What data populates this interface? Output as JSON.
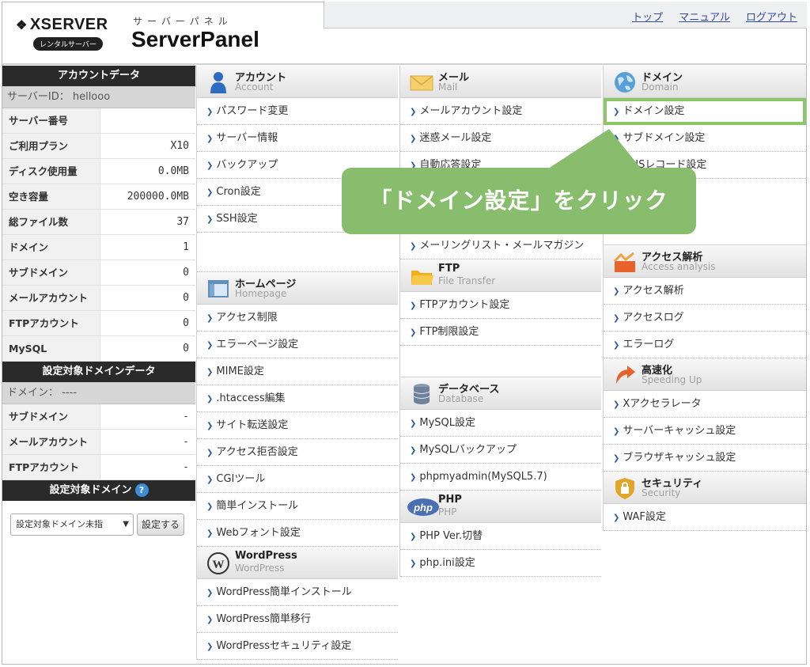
{
  "brand": {
    "xserver": "XSERVER",
    "rental": "レンタルサーバー",
    "kana": "サーバーパネル",
    "panel": "ServerPanel"
  },
  "top_links": [
    "トップ",
    "マニュアル",
    "ログアウト"
  ],
  "account_data": {
    "title": "アカウントデータ",
    "server_id": "サーバーID： hellooo",
    "rows": [
      {
        "label": "サーバー番号",
        "value": ""
      },
      {
        "label": "ご利用プラン",
        "value": "X10"
      },
      {
        "label": "ディスク使用量",
        "value": "0.0MB"
      },
      {
        "label": "空き容量",
        "value": "200000.0MB"
      },
      {
        "label": "総ファイル数",
        "value": "37"
      },
      {
        "label": "ドメイン",
        "value": "1"
      },
      {
        "label": "サブドメイン",
        "value": "0"
      },
      {
        "label": "メールアカウント",
        "value": "0"
      },
      {
        "label": "FTPアカウント",
        "value": "0"
      },
      {
        "label": "MySQL",
        "value": "0"
      }
    ]
  },
  "domain_data": {
    "title": "設定対象ドメインデータ",
    "domain": "ドメイン： ----",
    "rows": [
      {
        "label": "サブドメイン",
        "value": "-"
      },
      {
        "label": "メールアカウント",
        "value": "-"
      },
      {
        "label": "FTPアカウント",
        "value": "-"
      }
    ]
  },
  "target_domain": {
    "title": "設定対象ドメイン",
    "help": "?",
    "select": "設定対象ドメイン未指",
    "button": "設定する"
  },
  "sections": {
    "account": {
      "title": "アカウント",
      "sub": "Account",
      "items": [
        "パスワード変更",
        "サーバー情報",
        "バックアップ",
        "Cron設定",
        "SSH設定"
      ]
    },
    "homepage": {
      "title": "ホームページ",
      "sub": "Homepage",
      "items": [
        "アクセス制限",
        "エラーページ設定",
        "MIME設定",
        ".htaccess編集",
        "サイト転送設定",
        "アクセス拒否設定",
        "CGIツール",
        "簡単インストール",
        "Webフォント設定"
      ]
    },
    "wordpress": {
      "title": "WordPress",
      "sub": "WordPress",
      "items": [
        "WordPress簡単インストール",
        "WordPress簡単移行",
        "WordPressセキュリティ設定"
      ]
    },
    "mail": {
      "title": "メール",
      "sub": "Mail",
      "items": [
        "メールアカウント設定",
        "迷惑メール設定",
        "自動応答設定",
        "",
        "",
        "メーリングリスト・メールマガジン"
      ]
    },
    "ftp": {
      "title": "FTP",
      "sub": "File Transfer",
      "items": [
        "FTPアカウント設定",
        "FTP制限設定"
      ]
    },
    "database": {
      "title": "データベース",
      "sub": "Database",
      "items": [
        "MySQL設定",
        "MySQLバックアップ",
        "phpmyadmin(MySQL5.7)"
      ]
    },
    "php": {
      "title": "PHP",
      "sub": "PHP",
      "items": [
        "PHP Ver.切替",
        "php.ini設定"
      ]
    },
    "domain": {
      "title": "ドメイン",
      "sub": "Domain",
      "items": [
        "ドメイン設定",
        "サブドメイン設定",
        "DNSレコード設定"
      ]
    },
    "access": {
      "title": "アクセス解析",
      "sub": "Access analysis",
      "items": [
        "アクセス解析",
        "アクセスログ",
        "エラーログ"
      ]
    },
    "speed": {
      "title": "高速化",
      "sub": "Speeding Up",
      "items": [
        "Xアクセラレータ",
        "サーバーキャッシュ設定",
        "ブラウザキャッシュ設定"
      ]
    },
    "security": {
      "title": "セキュリティ",
      "sub": "Security",
      "items": [
        "WAF設定"
      ]
    }
  },
  "callout": "「ドメイン設定」をクリック",
  "colors": {
    "accent_green": "#87bd6d",
    "link": "#3b4b9a",
    "sidebar_header": "#2a2a2a"
  }
}
